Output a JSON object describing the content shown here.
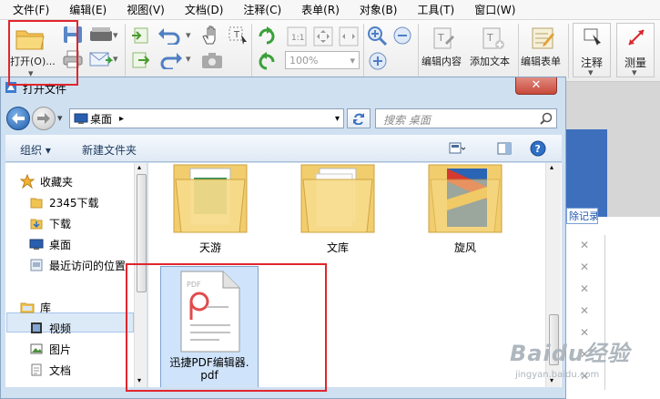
{
  "menu": [
    "文件(F)",
    "编辑(E)",
    "视图(V)",
    "文档(D)",
    "注释(C)",
    "表单(R)",
    "对象(B)",
    "工具(T)",
    "窗口(W)"
  ],
  "toolbar": {
    "open_label": "打开(O)...",
    "zoom_value": "100%",
    "edit_content": "编辑内容",
    "add_text": "添加文本",
    "edit_form": "编辑表单",
    "annotate": "注释",
    "measure": "测量"
  },
  "dialog": {
    "title": "打开文件",
    "close_label": "✕",
    "address_location": "桌面",
    "search_placeholder": "搜索 桌面",
    "cmd_organize": "组织 ▾",
    "cmd_new_folder": "新建文件夹"
  },
  "nav": {
    "favorites": "收藏夹",
    "items": [
      "2345下载",
      "下载",
      "桌面",
      "最近访问的位置"
    ],
    "library": "库",
    "lib_items": [
      "视频",
      "图片",
      "文档"
    ]
  },
  "files": [
    {
      "name": "天游"
    },
    {
      "name": "文库"
    },
    {
      "name": "旋风"
    },
    {
      "name_line1": "迅捷PDF编辑器.",
      "name_line2": "pdf",
      "badge": "PDF"
    }
  ],
  "background_doc": {
    "record_text": "除记录"
  },
  "watermark": {
    "big": "Baidu经验",
    "small": "jingyan.baidu.com"
  },
  "colors": {
    "highlight": "#e0262d",
    "titlebar": "#cfe0f1",
    "selection": "#cfe4fb"
  }
}
